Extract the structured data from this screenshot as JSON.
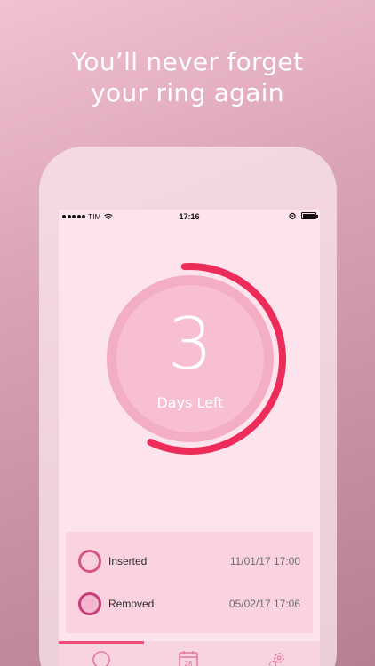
{
  "headline": {
    "line1": "You’ll never forget",
    "line2": "your ring again"
  },
  "statusbar": {
    "carrier": "TIM",
    "time": "17:16",
    "icons": [
      "signal-dots-icon",
      "wifi-icon",
      "alarm-icon",
      "battery-icon"
    ]
  },
  "countdown": {
    "value": "3",
    "label": "Days Left",
    "progress_fraction": 0.58,
    "colors": {
      "ring": "#ee2c5a",
      "inner": "#f8bfd0",
      "track": "#f3aec4"
    }
  },
  "events": [
    {
      "name": "Inserted",
      "date": "11/01/17 17:00",
      "icon": "ring-inserted-icon"
    },
    {
      "name": "Removed",
      "date": "05/02/17 17:06",
      "icon": "ring-removed-icon"
    }
  ],
  "tabbar": {
    "tabs": [
      {
        "icon": "ring-tab-icon",
        "active": true
      },
      {
        "icon": "calendar-tab-icon",
        "label": "28",
        "active": false
      },
      {
        "icon": "settings-tab-icon",
        "active": false
      }
    ],
    "accent": "#ee4b7b"
  }
}
